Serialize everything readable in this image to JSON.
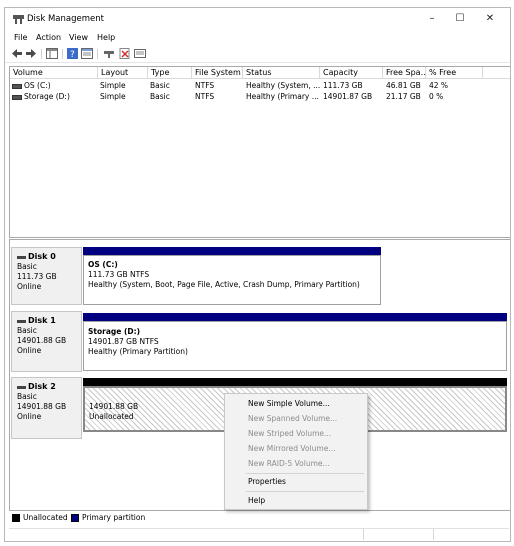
{
  "window": {
    "title": "Disk Management",
    "min_glyph": "–",
    "max_glyph": "☐",
    "close_glyph": "✕"
  },
  "menu": [
    "File",
    "Action",
    "View",
    "Help"
  ],
  "toolbar_icons": [
    "back-icon",
    "forward-icon",
    "console-tree-icon",
    "help-icon",
    "properties-icon",
    "connect-icon",
    "delete-icon",
    "list-icon"
  ],
  "volumes": {
    "columns": [
      "Volume",
      "Layout",
      "Type",
      "File System",
      "Status",
      "Capacity",
      "Free Spa...",
      "% Free"
    ],
    "rows": [
      [
        "OS (C:)",
        "Simple",
        "Basic",
        "NTFS",
        "Healthy (System, ...",
        "111.73 GB",
        "46.81 GB",
        "42 %"
      ],
      [
        "Storage (D:)",
        "Simple",
        "Basic",
        "NTFS",
        "Healthy (Primary ...",
        "14901.87 GB",
        "21.17 GB",
        "0 %"
      ]
    ]
  },
  "disks": [
    {
      "name": "Disk 0",
      "type": "Basic",
      "size": "111.73 GB",
      "status": "Online",
      "partition": {
        "name": "OS (C:)",
        "detail": "111.73 GB NTFS",
        "status": "Healthy (System, Boot, Page File, Active, Crash Dump, Primary Partition)"
      }
    },
    {
      "name": "Disk 1",
      "type": "Basic",
      "size": "14901.88 GB",
      "status": "Online",
      "partition": {
        "name": "Storage (D:)",
        "detail": "14901.87 GB NTFS",
        "status": "Healthy (Primary Partition)"
      }
    },
    {
      "name": "Disk 2",
      "type": "Basic",
      "size": "14901.88 GB",
      "status": "Online",
      "partition": {
        "size": "14901.88 GB",
        "status": "Unallocated"
      }
    }
  ],
  "legend": {
    "unallocated": "Unallocated",
    "primary": "Primary partition"
  },
  "colors": {
    "primary": "#000080",
    "unallocated": "#000000"
  },
  "context_menu": {
    "items": [
      {
        "label": "New Simple Volume...",
        "enabled": true
      },
      {
        "label": "New Spanned Volume...",
        "enabled": false
      },
      {
        "label": "New Striped Volume...",
        "enabled": false
      },
      {
        "label": "New Mirrored Volume...",
        "enabled": false
      },
      {
        "label": "New RAID-5 Volume...",
        "enabled": false
      },
      {
        "label": "Properties",
        "enabled": true
      },
      {
        "label": "Help",
        "enabled": true
      }
    ]
  }
}
